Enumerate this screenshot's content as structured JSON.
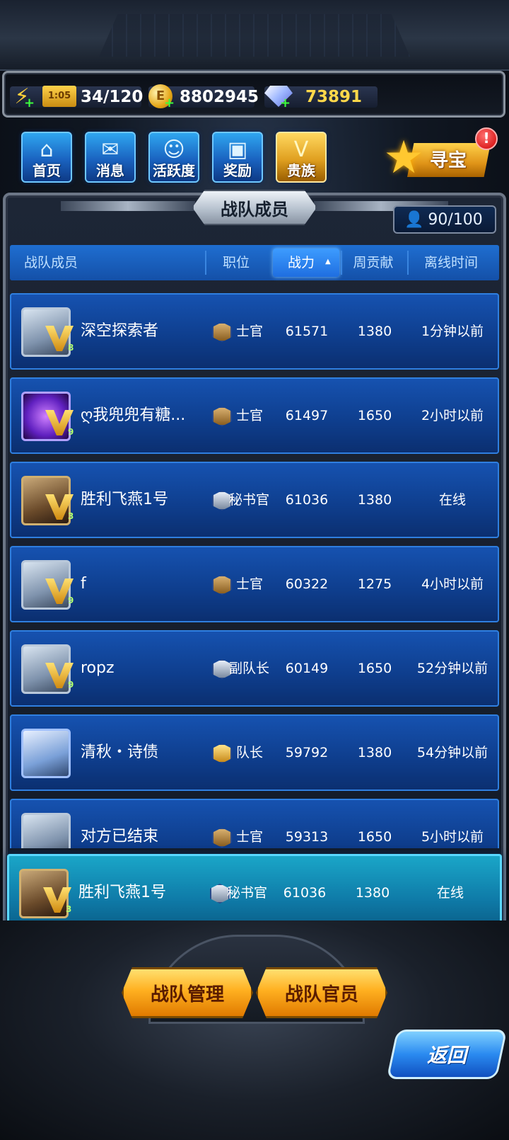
{
  "resources": {
    "energy_timer": "1:05",
    "energy": "34/120",
    "coins": "8802945",
    "gems": "73891"
  },
  "nav": [
    {
      "label": "首页",
      "icon": "home-icon"
    },
    {
      "label": "消息",
      "icon": "mail-icon"
    },
    {
      "label": "活跃度",
      "icon": "activity-icon"
    },
    {
      "label": "奖励",
      "icon": "gift-icon"
    },
    {
      "label": "贵族",
      "icon": "vip-icon"
    }
  ],
  "treasure": {
    "label": "寻宝",
    "alert": "!"
  },
  "panel": {
    "title": "战队成员",
    "member_count": "90/100"
  },
  "table": {
    "headers": [
      "战队成员",
      "职位",
      "战力",
      "周贡献",
      "离线时间"
    ],
    "sorted_column": "战力",
    "rows": [
      {
        "name": "深空探索者",
        "rank": "士官",
        "power": "61571",
        "weekly": "1380",
        "offline": "1分钟以前",
        "vlevel": "8"
      },
      {
        "name": "ღ我兜兜有糖...",
        "rank": "士官",
        "power": "61497",
        "weekly": "1650",
        "offline": "2小时以前",
        "vlevel": "9"
      },
      {
        "name": "胜利飞燕1号",
        "rank": "秘书官",
        "power": "61036",
        "weekly": "1380",
        "offline": "在线",
        "vlevel": "3"
      },
      {
        "name": "f",
        "rank": "士官",
        "power": "60322",
        "weekly": "1275",
        "offline": "4小时以前",
        "vlevel": "9"
      },
      {
        "name": "ropz",
        "rank": "副队长",
        "power": "60149",
        "weekly": "1650",
        "offline": "52分钟以前",
        "vlevel": "9"
      },
      {
        "name": "清秋・诗债",
        "rank": "队长",
        "power": "59792",
        "weekly": "1380",
        "offline": "54分钟以前",
        "vlevel": ""
      },
      {
        "name": "对方已结束",
        "rank": "士官",
        "power": "59313",
        "weekly": "1650",
        "offline": "5小时以前",
        "vlevel": ""
      }
    ],
    "self_row": {
      "name": "胜利飞燕1号",
      "rank": "秘书官",
      "power": "61036",
      "weekly": "1380",
      "offline": "在线",
      "vlevel": "3"
    }
  },
  "buttons": {
    "manage": "战队管理",
    "officers": "战队官员",
    "back": "返回"
  },
  "colors": {
    "row_blue": "#1652b0",
    "highlight_cyan": "#1aa6c8",
    "gold": "#ffb020"
  }
}
